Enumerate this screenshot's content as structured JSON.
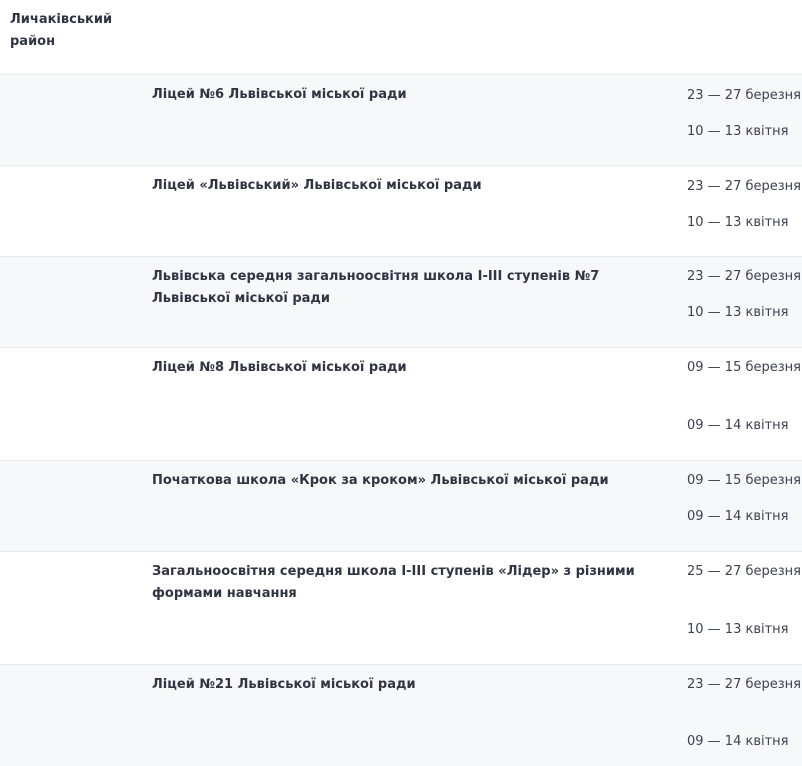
{
  "district": {
    "name": "Личаківський район"
  },
  "schools": [
    {
      "name": "Ліцей №6 Львівської міської ради",
      "date1": "23 — 27 березня;",
      "date2": "10 — 13 квітня"
    },
    {
      "name": "Ліцей «Львівський» Львівської міської ради",
      "date1": "23 — 27 березня;",
      "date2": "10 — 13 квітня"
    },
    {
      "name": "Львівська середня загальноосвітня школа І-ІІІ ступенів №7 Львівської міської ради",
      "date1": "23 — 27 березня;",
      "date2": "10 — 13 квітня"
    },
    {
      "name": "Ліцей №8 Львівської міської ради",
      "date1": "09 — 15 березня",
      "date2": "09 — 14 квітня"
    },
    {
      "name": "Початкова школа «Крок за кроком» Львівської міської ради",
      "date1": "09 — 15 березня",
      "date2": "09 — 14 квітня"
    },
    {
      "name": "Загальноосвітня середня школа І-ІІІ ступенів «Лідер» з різними формами навчання",
      "date1": "25 — 27 березня",
      "date2": "10 — 13 квітня"
    },
    {
      "name": "Ліцей №21 Львівської міської ради",
      "date1": "23 — 27 березня",
      "date2": "09 — 14 квітня"
    }
  ]
}
